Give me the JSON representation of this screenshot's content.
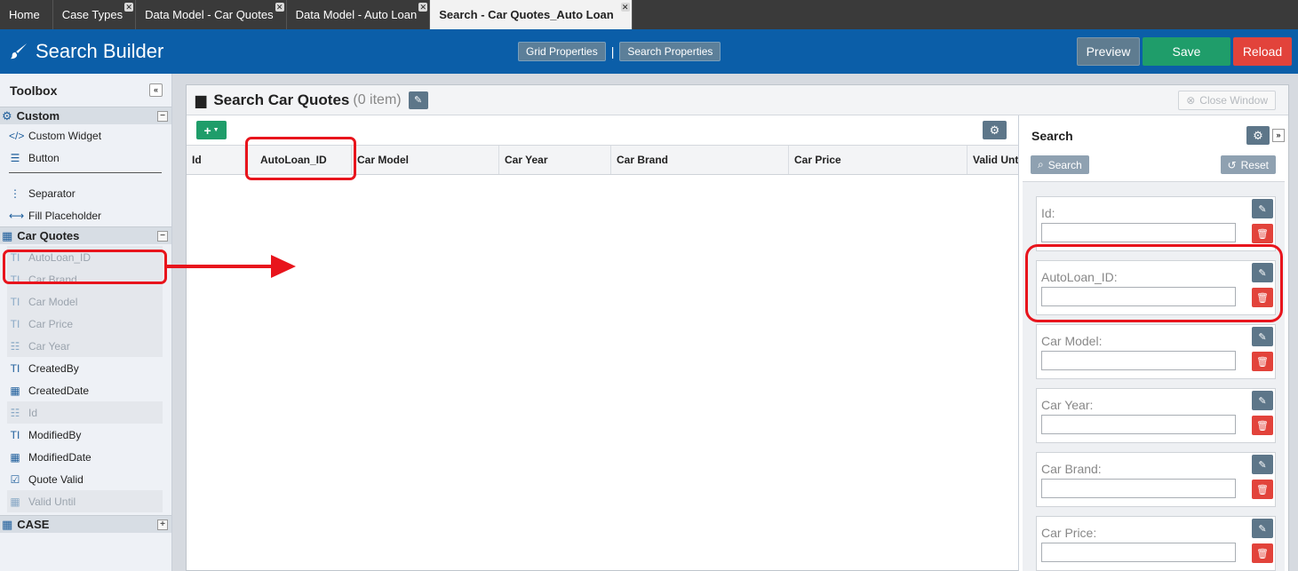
{
  "tabs": [
    {
      "label": "Home",
      "closable": false
    },
    {
      "label": "Case Types",
      "closable": true
    },
    {
      "label": "Data Model - Car Quotes",
      "closable": true
    },
    {
      "label": "Data Model - Auto Loan",
      "closable": true
    },
    {
      "label": "Search - Car Quotes_Auto Loan",
      "closable": true,
      "active": true
    }
  ],
  "header": {
    "title": "Search Builder",
    "grid_properties": "Grid Properties",
    "separator": "|",
    "search_properties": "Search Properties",
    "preview": "Preview",
    "save": "Save",
    "reload": "Reload"
  },
  "toolbox": {
    "title": "Toolbox",
    "groups": {
      "custom": {
        "label": "Custom",
        "items": [
          "Custom Widget",
          "Button",
          "Separator",
          "Fill Placeholder"
        ]
      },
      "car_quotes": {
        "label": "Car Quotes",
        "items": [
          "AutoLoan_ID",
          "Car Brand",
          "Car Model",
          "Car Price",
          "Car Year",
          "CreatedBy",
          "CreatedDate",
          "Id",
          "ModifiedBy",
          "ModifiedDate",
          "Quote Valid",
          "Valid Until"
        ]
      },
      "case": {
        "label": "CASE"
      }
    }
  },
  "panel": {
    "title": "Search Car Quotes",
    "count": "(0 item)",
    "close_window": "Close Window"
  },
  "grid": {
    "columns": [
      "Id",
      "AutoLoan_ID",
      "Car Model",
      "Car Year",
      "Car Brand",
      "Car Price",
      "Valid Until"
    ]
  },
  "search": {
    "title": "Search",
    "search_button": "Search",
    "reset_button": "Reset",
    "fields": [
      "Id:",
      "AutoLoan_ID:",
      "Car Model:",
      "Car Year:",
      "Car Brand:",
      "Car Price:"
    ]
  },
  "colors": {
    "header_blue": "#0b5ea8",
    "save_green": "#1f9d6a",
    "reload_red": "#e2433b",
    "annotation_red": "#e8141c"
  }
}
